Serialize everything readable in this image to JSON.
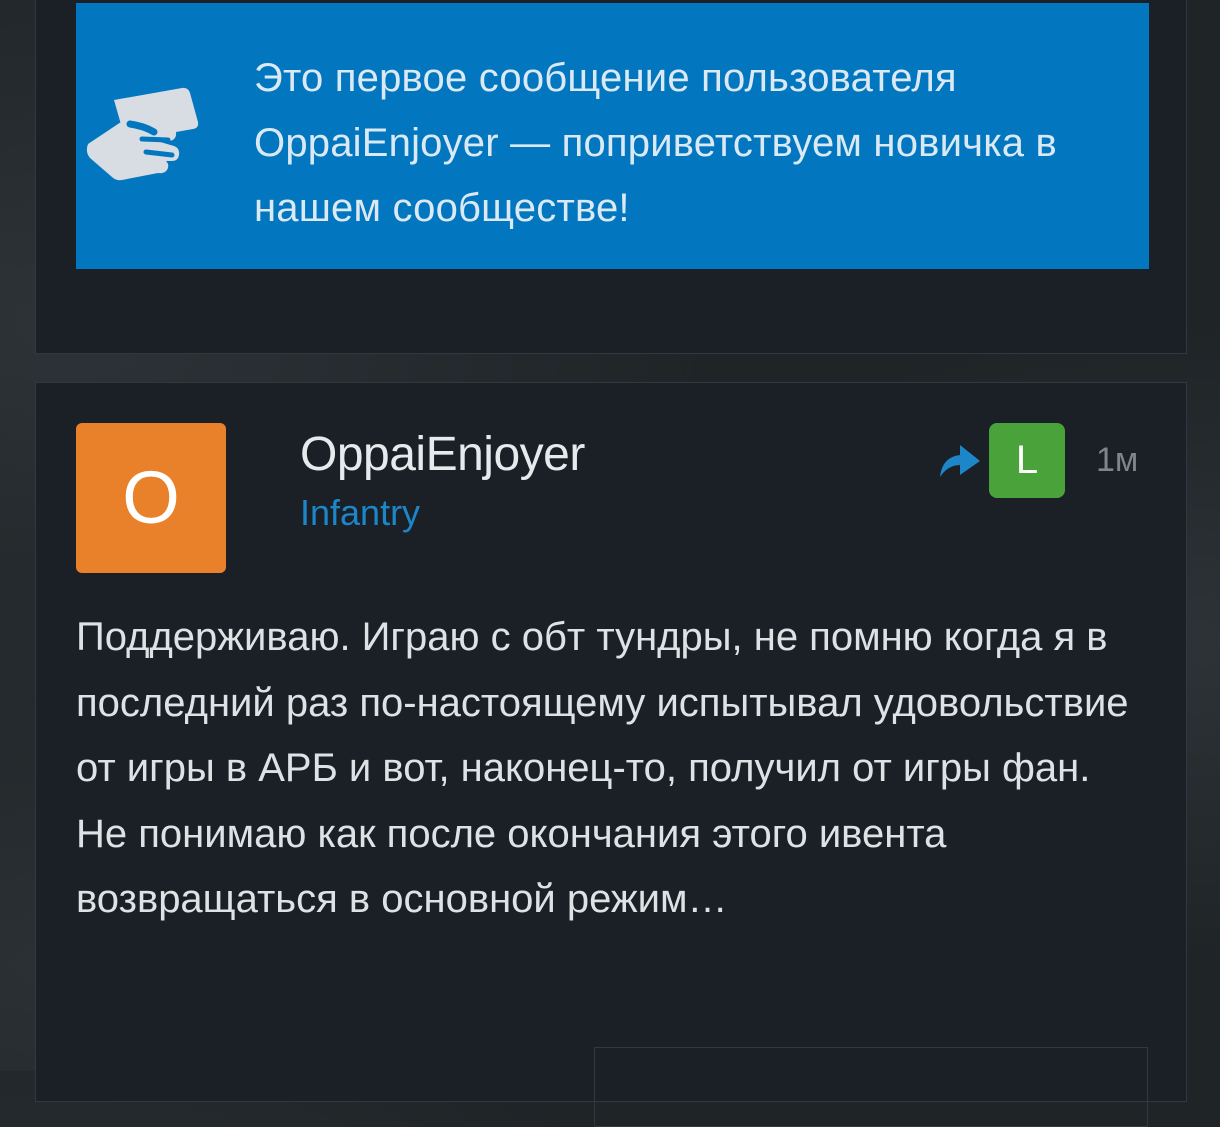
{
  "welcome_banner": {
    "icon": "handshake-icon",
    "text": "Это первое сообщение пользователя OppaiEnjoyer — поприветствуем новичка в нашем сообществе!",
    "background_color": "#0277bf"
  },
  "post": {
    "avatar_letter": "O",
    "avatar_color": "#e8812a",
    "author": "OppaiEnjoyer",
    "rank": "Infantry",
    "reply_icon": "reply-arrow-icon",
    "language_badge": "L",
    "language_badge_color": "#4aa33a",
    "time": "1м",
    "body": "Поддерживаю. Играю с обт тундры, не помню когда я в последний раз по-настоящему испытывал удовольствие от игры в АРБ и вот, наконец-то, получил от игры фан. Не понимаю как после окончания этого ивента возвращаться в основной режим…"
  }
}
